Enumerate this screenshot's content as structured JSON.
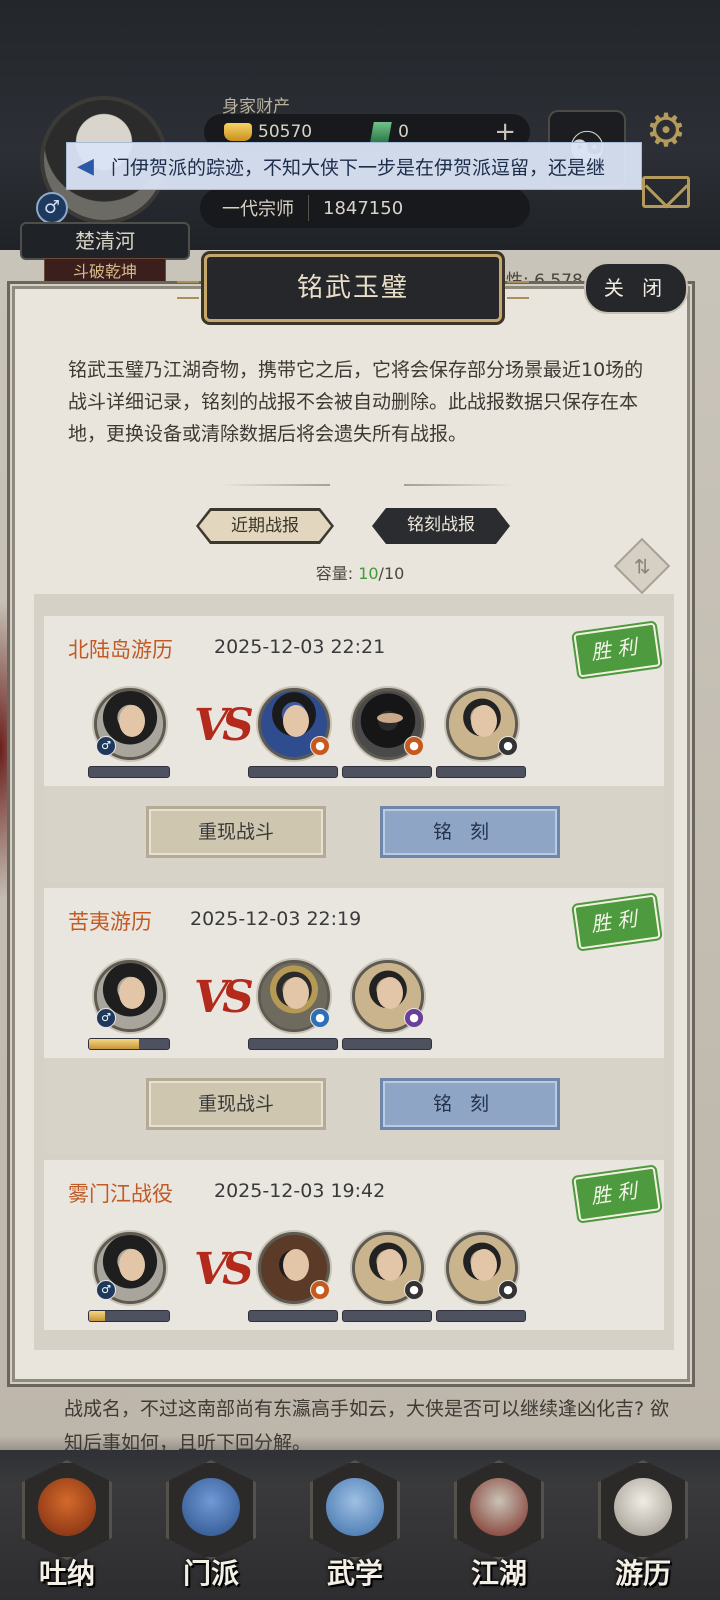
{
  "hud": {
    "wealth_label": "身家财产",
    "gold": "50570",
    "gems": "0",
    "plus_glyph": "+",
    "rank": "一代宗师",
    "power": "1847150",
    "player_name": "楚清河",
    "player_title": "斗破乾坤",
    "gender_glyph": "♂",
    "stat_peek": "性: 6,578",
    "yinyang_glyph": "☯",
    "gear_glyph": "⚙"
  },
  "marquee": {
    "icon": "horn-icon",
    "text": "门伊贺派的踪迹，不知大侠下一步是在伊贺派逗留，还是继"
  },
  "panel": {
    "title": "铭武玉璧",
    "close_label": "关 闭",
    "description": "铭武玉璧乃江湖奇物，携带它之后，它将会保存部分场景最近10场的战斗详细记录，铭刻的战报不会被自动删除。此战报数据只保存在本地，更换设备或清除数据后将会遗失所有战报。",
    "tabs": {
      "recent": "近期战报",
      "engraved": "铭刻战报"
    },
    "capacity_label": "容量: ",
    "capacity_used": "10",
    "capacity_total": "/10"
  },
  "records": [
    {
      "title": "北陆岛游历",
      "time": "2025-12-03 22:21",
      "result": "胜利",
      "vs": "VS",
      "player_hp": 0,
      "enemy_count": 3,
      "replay_label": "重现战斗",
      "engrave_label": "铭刻"
    },
    {
      "title": "苦夷游历",
      "time": "2025-12-03 22:19",
      "result": "胜利",
      "vs": "VS",
      "player_hp": 0.62,
      "enemy_count": 2,
      "replay_label": "重现战斗",
      "engrave_label": "铭刻"
    },
    {
      "title": "雾门江战役",
      "time": "2025-12-03 19:42",
      "result": "胜利",
      "vs": "VS",
      "player_hp": 0.2,
      "enemy_count": 3
    }
  ],
  "story": "战成名，不过这南部尚有东瀛高手如云，大侠是否可以继续逢凶化吉? 欲知后事如何，且听下回分解。",
  "nav": [
    {
      "label": "吐纳",
      "icon": "gourd-icon",
      "color": "#a84a1e"
    },
    {
      "label": "门派",
      "icon": "banner-icon",
      "color": "#3c6db0"
    },
    {
      "label": "武学",
      "icon": "scroll-icon",
      "color": "#4a7fb8"
    },
    {
      "label": "江湖",
      "icon": "hat-icon",
      "color": "#8a2a22"
    },
    {
      "label": "游历",
      "icon": "horse-icon",
      "color": "#d9d4cb"
    }
  ],
  "colors": {
    "title_orange": "#c25a25",
    "win_green": "#4e9a3e",
    "engrave_blue": "#8ea5c6",
    "capacity_green": "#3f9a3a"
  }
}
